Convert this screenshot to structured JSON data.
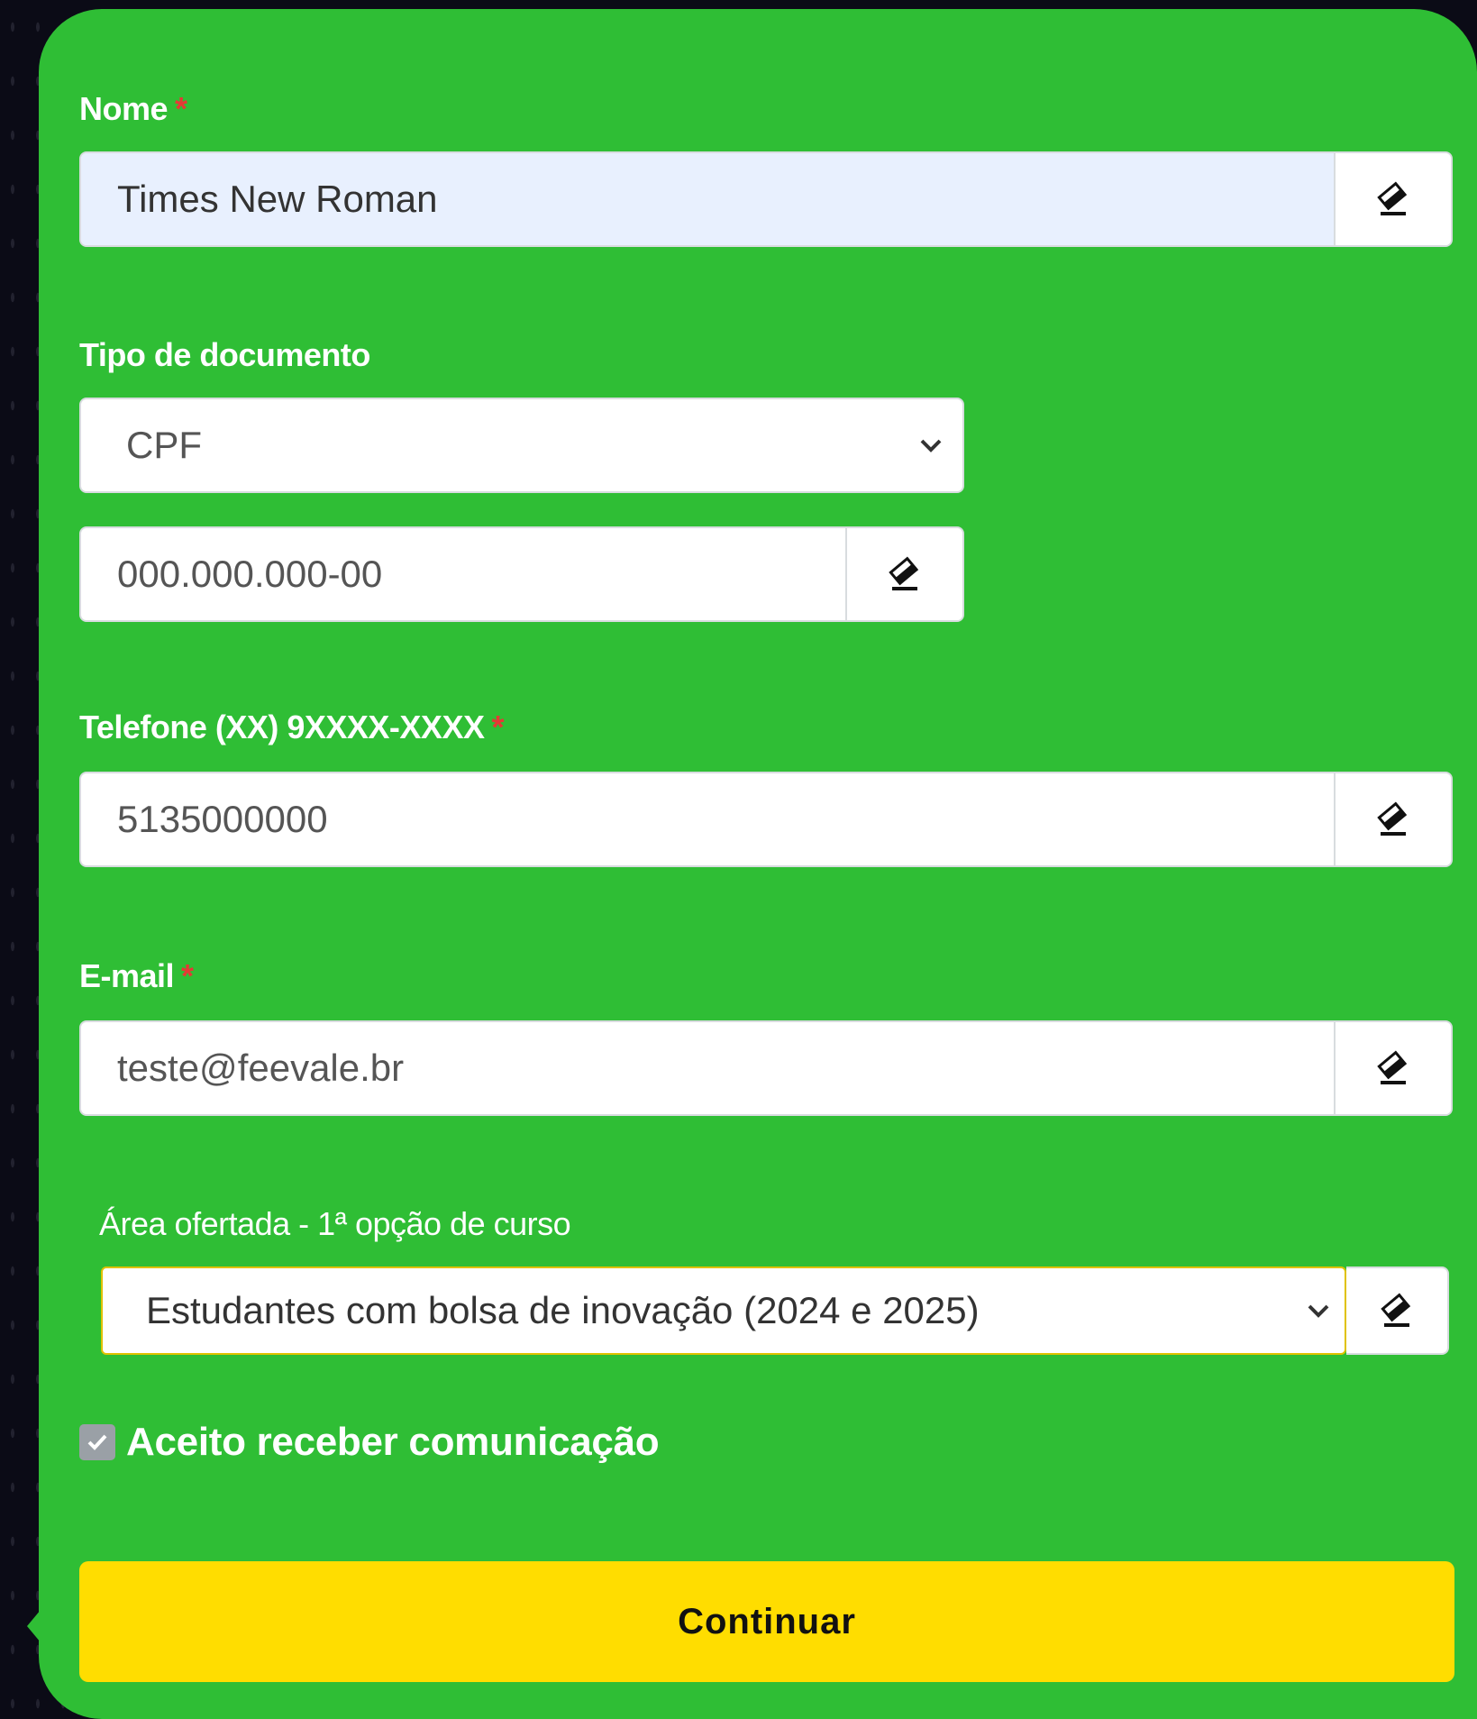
{
  "form": {
    "nome": {
      "label": "Nome",
      "required_mark": "*",
      "value": "Times New Roman"
    },
    "documento": {
      "label": "Tipo de documento",
      "type_selected": "CPF",
      "number_value": "000.000.000-00"
    },
    "telefone": {
      "label": "Telefone (XX) 9XXXX-XXXX",
      "required_mark": "*",
      "value": "5135000000"
    },
    "email": {
      "label": "E-mail",
      "required_mark": "*",
      "value": "teste@feevale.br"
    },
    "area": {
      "label": "Área ofertada - 1ª opção de curso",
      "selected": "Estudantes com bolsa de inovação (2024 e 2025)"
    },
    "consent": {
      "label": "Aceito receber comunicação",
      "checked": true
    },
    "submit_label": "Continuar"
  },
  "icons": {
    "clear": "eraser-icon",
    "dropdown": "chevron-down-icon",
    "check": "checkmark-icon"
  },
  "colors": {
    "card_background": "#2fbe35",
    "button_background": "#ffdd00",
    "required": "#e53935",
    "autofill": "#e8f0fe"
  }
}
